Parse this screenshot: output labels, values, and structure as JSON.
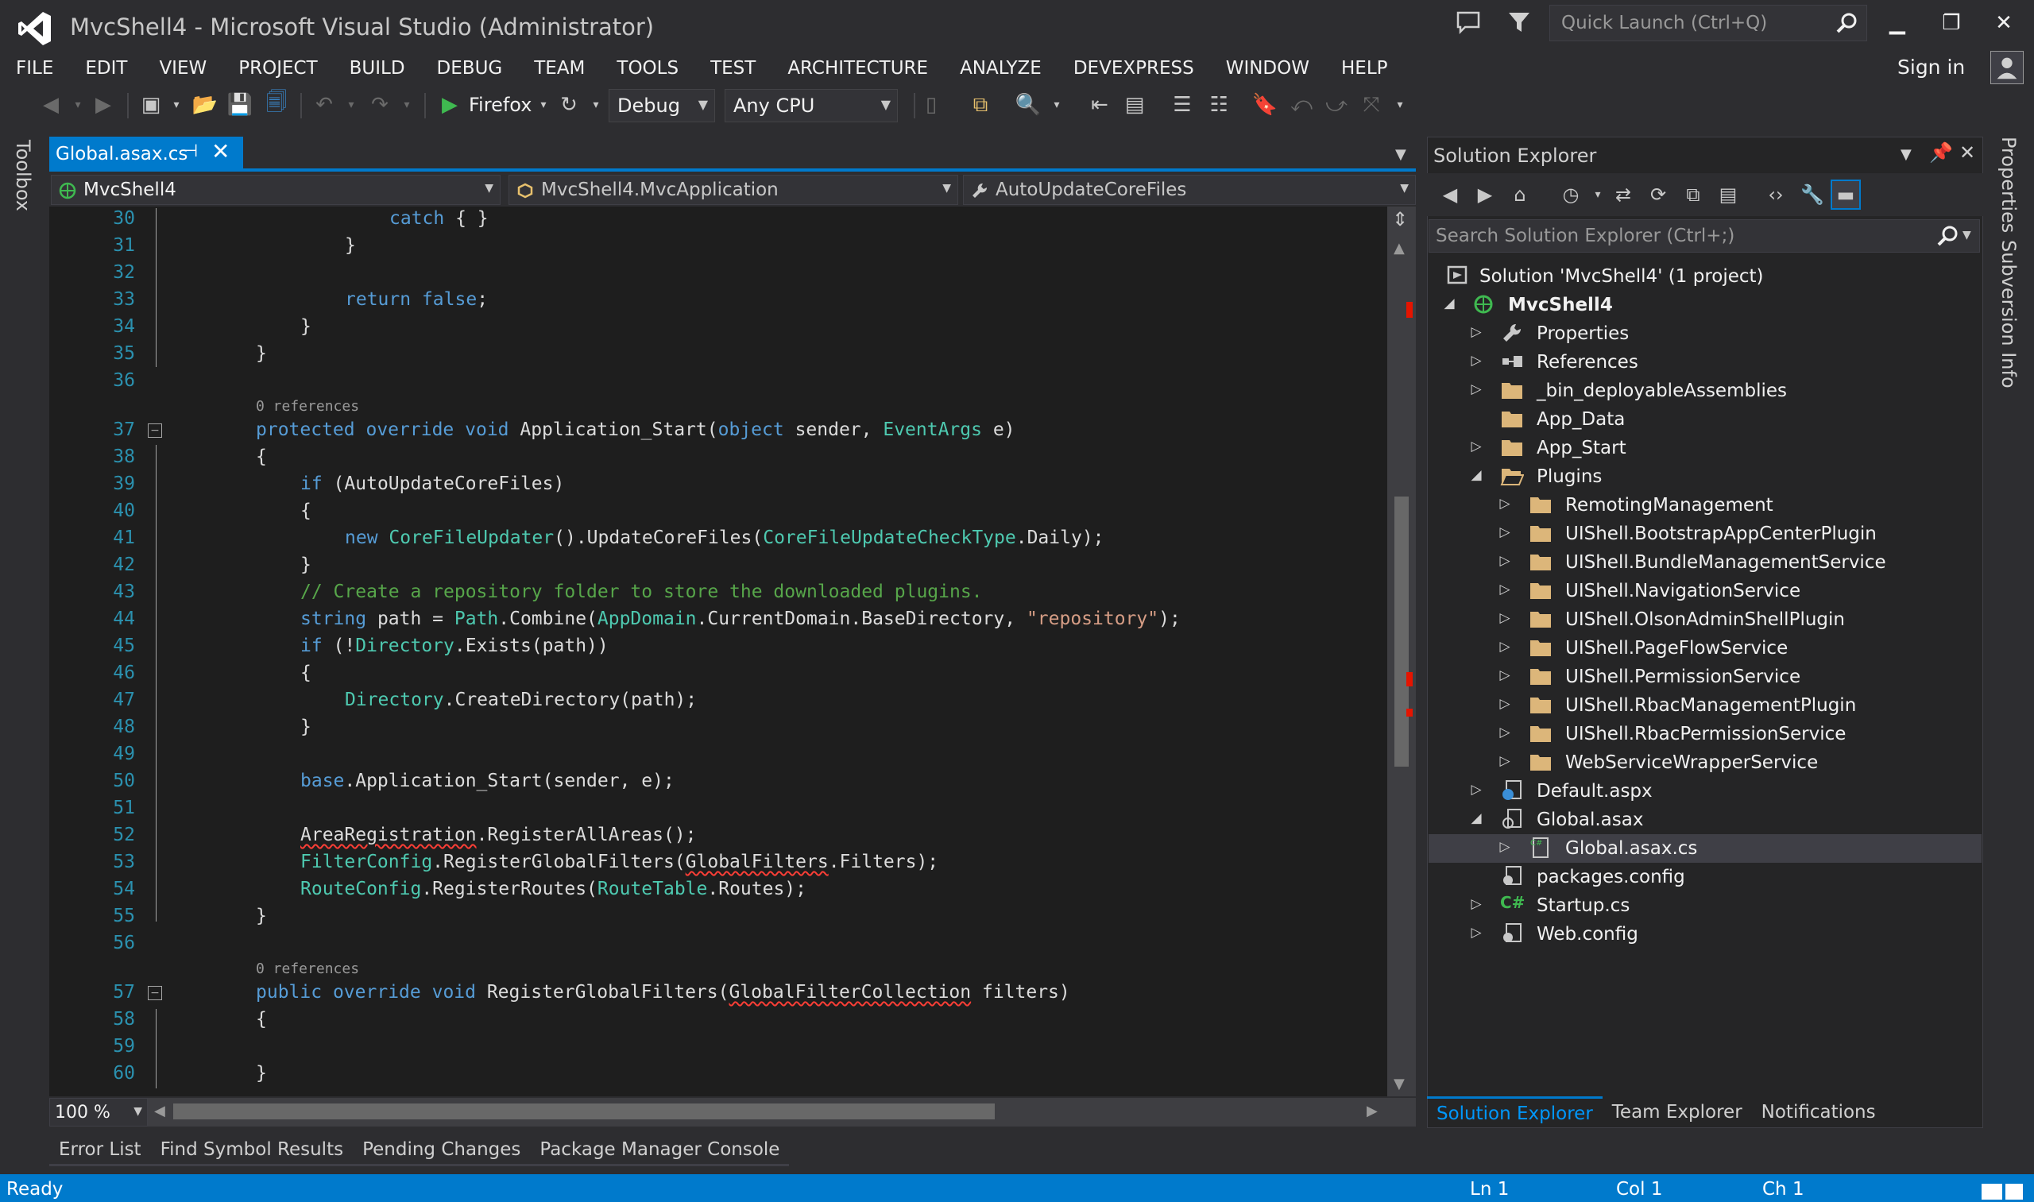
{
  "window": {
    "title": "MvcShell4 - Microsoft Visual Studio (Administrator)",
    "quick_launch_placeholder": "Quick Launch (Ctrl+Q)",
    "minimize": "▁",
    "restore": "❐",
    "close": "✕",
    "sign_in": "Sign in"
  },
  "menu": [
    "FILE",
    "EDIT",
    "VIEW",
    "PROJECT",
    "BUILD",
    "DEBUG",
    "TEAM",
    "TOOLS",
    "TEST",
    "ARCHITECTURE",
    "ANALYZE",
    "DEVEXPRESS",
    "WINDOW",
    "HELP"
  ],
  "toolbar": {
    "run_target": "Firefox",
    "configuration": "Debug",
    "platform": "Any CPU"
  },
  "left_rail": {
    "toolbox": "Toolbox"
  },
  "editor": {
    "tab": {
      "label": "Global.asax.cs",
      "pin": "⊣",
      "close": "✕"
    },
    "nav": {
      "project": "MvcShell4",
      "type": "MvcShell4.MvcApplication",
      "member": "AutoUpdateCoreFiles"
    },
    "zoom": "100 %",
    "codelens_1": "0 references",
    "codelens_2": "0 references",
    "lines": [
      {
        "n": "30"
      },
      {
        "n": "31"
      },
      {
        "n": "32"
      },
      {
        "n": "33"
      },
      {
        "n": "34"
      },
      {
        "n": "35"
      },
      {
        "n": "36"
      },
      {
        "n": "37"
      },
      {
        "n": "38"
      },
      {
        "n": "39"
      },
      {
        "n": "40"
      },
      {
        "n": "41"
      },
      {
        "n": "42"
      },
      {
        "n": "43"
      },
      {
        "n": "44"
      },
      {
        "n": "45"
      },
      {
        "n": "46"
      },
      {
        "n": "47"
      },
      {
        "n": "48"
      },
      {
        "n": "49"
      },
      {
        "n": "50"
      },
      {
        "n": "51"
      },
      {
        "n": "52"
      },
      {
        "n": "53"
      },
      {
        "n": "54"
      },
      {
        "n": "55"
      },
      {
        "n": "56"
      },
      {
        "n": "57"
      },
      {
        "n": "58"
      },
      {
        "n": "59"
      },
      {
        "n": "60"
      }
    ],
    "code": {
      "l30": [
        "catch",
        " { }"
      ],
      "l31": "}",
      "l33": [
        "return",
        " ",
        "false",
        ";"
      ],
      "l34": "}",
      "l35": "}",
      "l37": [
        "protected",
        " ",
        "override",
        " ",
        "void",
        " Application_Start(",
        "object",
        " sender, ",
        "EventArgs",
        " e)"
      ],
      "l38": "{",
      "l39": [
        "if",
        " (AutoUpdateCoreFiles)"
      ],
      "l40": "{",
      "l41": [
        "new",
        " ",
        "CoreFileUpdater",
        "().UpdateCoreFiles(",
        "CoreFileUpdateCheckType",
        ".Daily);"
      ],
      "l42": "}",
      "l43": "// Create a repository folder to store the downloaded plugins.",
      "l44": [
        "string",
        " path = ",
        "Path",
        ".Combine(",
        "AppDomain",
        ".CurrentDomain.BaseDirectory, ",
        "\"repository\"",
        ");"
      ],
      "l45": [
        "if",
        " (!",
        "Directory",
        ".Exists(path))"
      ],
      "l46": "{",
      "l47": [
        "Directory",
        ".CreateDirectory(path);"
      ],
      "l48": "}",
      "l50": [
        "base",
        ".Application_Start(sender, e);"
      ],
      "l52": [
        "AreaRegistration",
        ".RegisterAllAreas();"
      ],
      "l53": [
        "FilterConfig",
        ".RegisterGlobalFilters(",
        "GlobalFilters",
        ".Filters);"
      ],
      "l54": [
        "RouteConfig",
        ".RegisterRoutes(",
        "RouteTable",
        ".Routes);"
      ],
      "l55": "}",
      "l57": [
        "public",
        " ",
        "override",
        " ",
        "void",
        " RegisterGlobalFilters(",
        "GlobalFilterCollection",
        " filters)"
      ],
      "l58": "{",
      "l60": "}"
    }
  },
  "bottom_tabs": [
    "Error List",
    "Find Symbol Results",
    "Pending Changes",
    "Package Manager Console"
  ],
  "status": {
    "ready": "Ready",
    "ln": "Ln 1",
    "col": "Col 1",
    "ch": "Ch 1"
  },
  "solution_explorer": {
    "title": "Solution Explorer",
    "search_placeholder": "Search Solution Explorer (Ctrl+;)",
    "tree": [
      {
        "label": "Solution 'MvcShell4' (1 project)",
        "icon": "solution-icon"
      },
      {
        "label": "MvcShell4",
        "icon": "web-project-icon"
      },
      {
        "label": "Properties",
        "icon": "wrench-icon"
      },
      {
        "label": "References",
        "icon": "references-icon"
      },
      {
        "label": "_bin_deployableAssemblies",
        "icon": "folder-icon"
      },
      {
        "label": "App_Data",
        "icon": "folder-icon"
      },
      {
        "label": "App_Start",
        "icon": "folder-icon"
      },
      {
        "label": "Plugins",
        "icon": "folder-open-icon"
      },
      {
        "label": "RemotingManagement",
        "icon": "folder-icon"
      },
      {
        "label": "UIShell.BootstrapAppCenterPlugin",
        "icon": "folder-icon"
      },
      {
        "label": "UIShell.BundleManagementService",
        "icon": "folder-icon"
      },
      {
        "label": "UIShell.NavigationService",
        "icon": "folder-icon"
      },
      {
        "label": "UIShell.OlsonAdminShellPlugin",
        "icon": "folder-icon"
      },
      {
        "label": "UIShell.PageFlowService",
        "icon": "folder-icon"
      },
      {
        "label": "UIShell.PermissionService",
        "icon": "folder-icon"
      },
      {
        "label": "UIShell.RbacManagementPlugin",
        "icon": "folder-icon"
      },
      {
        "label": "UIShell.RbacPermissionService",
        "icon": "folder-icon"
      },
      {
        "label": "WebServiceWrapperService",
        "icon": "folder-icon"
      },
      {
        "label": "Default.aspx",
        "icon": "aspx-icon"
      },
      {
        "label": "Global.asax",
        "icon": "asax-icon"
      },
      {
        "label": "Global.asax.cs",
        "icon": "cs-file-icon"
      },
      {
        "label": "packages.config",
        "icon": "config-icon"
      },
      {
        "label": "Startup.cs",
        "icon": "csharp-icon"
      },
      {
        "label": "Web.config",
        "icon": "config-icon"
      }
    ],
    "bottom_tabs": [
      "Solution Explorer",
      "Team Explorer",
      "Notifications"
    ]
  },
  "right_rail": {
    "properties": "Properties",
    "subversion": "Subversion Info"
  },
  "colors": {
    "accent": "#007acc",
    "keyword": "#569cd6",
    "type": "#4ec9b0",
    "string": "#d69d85",
    "comment": "#57a64a",
    "linenum": "#2b91af",
    "error": "#fc3e36"
  }
}
